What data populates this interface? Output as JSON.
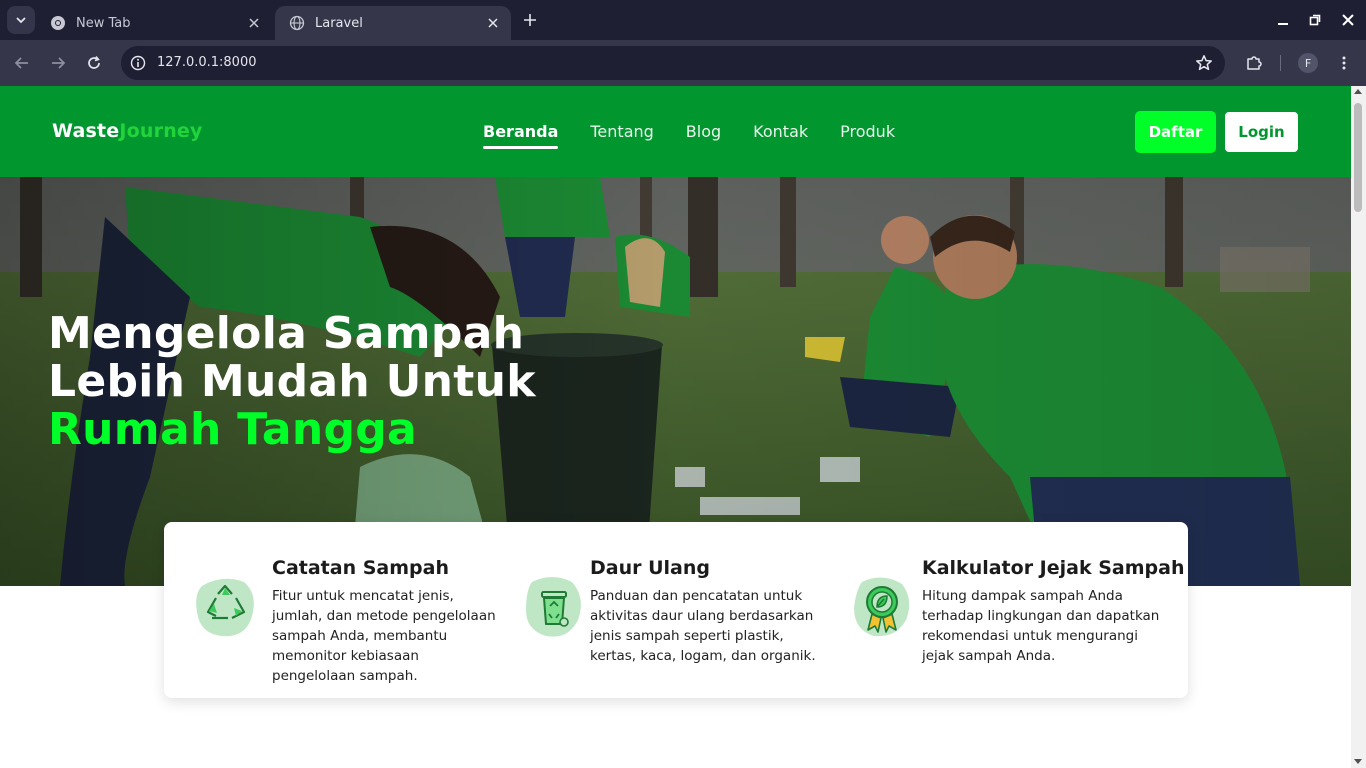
{
  "browser": {
    "tabs": [
      {
        "title": "New Tab",
        "active": false
      },
      {
        "title": "Laravel",
        "active": true
      }
    ],
    "url": "127.0.0.1:8000",
    "profile_initial": "F"
  },
  "site": {
    "logo_part1": "Waste",
    "logo_part2": "Journey",
    "nav": [
      {
        "label": "Beranda",
        "active": true
      },
      {
        "label": "Tentang",
        "active": false
      },
      {
        "label": "Blog",
        "active": false
      },
      {
        "label": "Kontak",
        "active": false
      },
      {
        "label": "Produk",
        "active": false
      }
    ],
    "register_label": "Daftar",
    "login_label": "Login"
  },
  "hero": {
    "line1": "Mengelola Sampah",
    "line2": "Lebih Mudah Untuk",
    "line3": "Rumah Tangga"
  },
  "features": [
    {
      "icon": "recycle-icon",
      "title": "Catatan Sampah",
      "description": "Fitur untuk mencatat jenis, jumlah, dan metode pengelolaan sampah Anda, membantu memonitor kebiasaan pengelolaan sampah."
    },
    {
      "icon": "recycle-bin-icon",
      "title": "Daur Ulang",
      "description": "Panduan dan pencatatan untuk aktivitas daur ulang berdasarkan jenis sampah seperti plastik, kertas, kaca, logam, dan organik."
    },
    {
      "icon": "eco-badge-icon",
      "title": "Kalkulator Jejak Sampah",
      "description": "Hitung dampak sampah Anda terhadap lingkungan dan dapatkan rekomendasi untuk mengurangi jejak sampah Anda."
    }
  ],
  "colors": {
    "brand_green": "#02962f",
    "accent_green": "#00ff28",
    "browser_dark": "#1f1f33"
  }
}
